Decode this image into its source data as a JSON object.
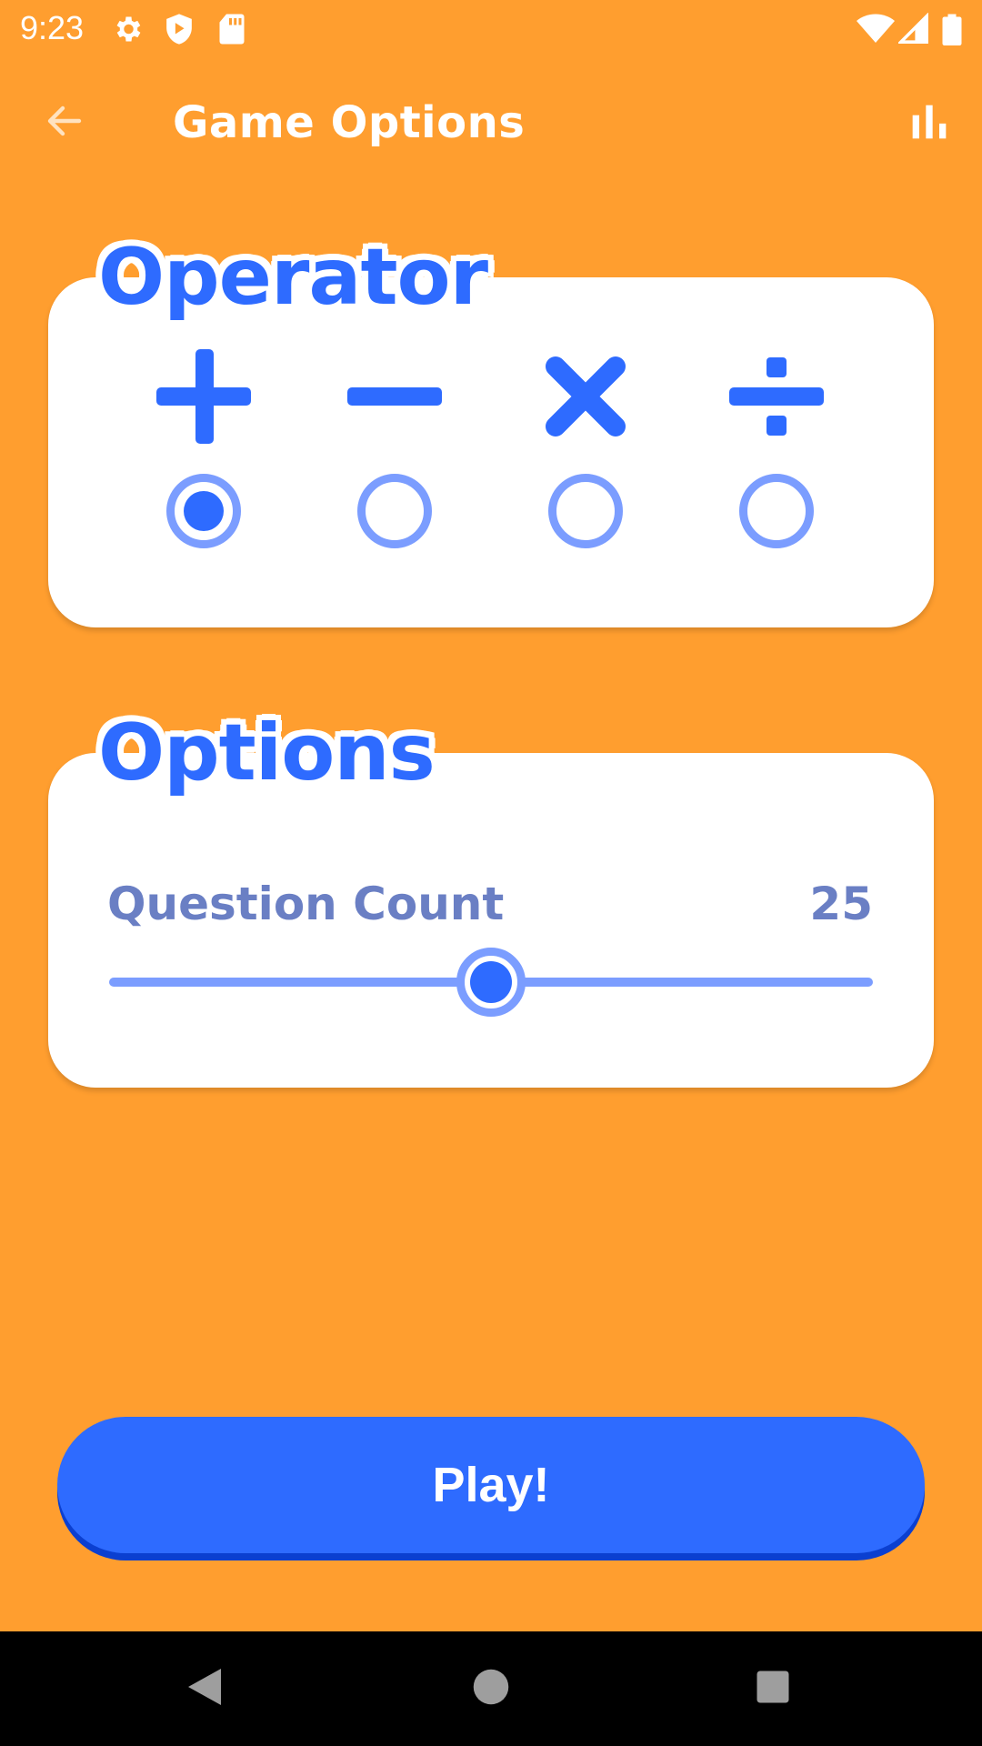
{
  "status_bar": {
    "time": "9:23",
    "icons": [
      "gear-icon",
      "shield-play-icon",
      "sd-card-icon",
      "wifi-icon",
      "signal-icon",
      "battery-icon"
    ]
  },
  "app_bar": {
    "title": "Game Options",
    "back_icon": "arrow-left-icon",
    "action_icon": "bar-chart-icon"
  },
  "operator_section": {
    "title": "Operator",
    "operators": [
      {
        "symbol": "plus-icon",
        "selected": true
      },
      {
        "symbol": "minus-icon",
        "selected": false
      },
      {
        "symbol": "multiply-icon",
        "selected": false
      },
      {
        "symbol": "divide-icon",
        "selected": false
      }
    ]
  },
  "options_section": {
    "title": "Options",
    "question_count_label": "Question Count",
    "question_count_value": "25",
    "slider_fraction": 0.5
  },
  "play_button": {
    "label": "Play!"
  },
  "nav_bar": {
    "icons": [
      "back-triangle-icon",
      "home-circle-icon",
      "recents-square-icon"
    ]
  },
  "colors": {
    "background": "#FF9E2F",
    "accent": "#2E6BFF",
    "accent_light": "#7B9DFF",
    "label": "#6A7FC4"
  }
}
